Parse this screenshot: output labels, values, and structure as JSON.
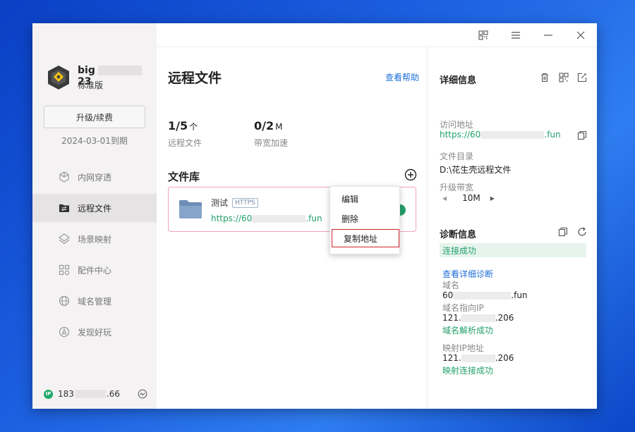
{
  "sidebar": {
    "user": {
      "name_prefix": "big",
      "name_suffix": "23",
      "edition": "标准版"
    },
    "upgrade_button": "升级/续费",
    "expire": "2024-03-01到期",
    "nav": [
      {
        "label": "内网穿透",
        "icon": "cube-icon"
      },
      {
        "label": "远程文件",
        "icon": "folder-transfer-icon",
        "active": true
      },
      {
        "label": "场景映射",
        "icon": "layers-icon"
      },
      {
        "label": "配件中心",
        "icon": "grid-icon"
      },
      {
        "label": "域名管理",
        "icon": "globe-icon"
      },
      {
        "label": "发现好玩",
        "icon": "compass-icon"
      }
    ],
    "ip": {
      "badge": "IP",
      "prefix": "183",
      "suffix": ".66"
    }
  },
  "main": {
    "title": "远程文件",
    "help_link": "查看帮助",
    "stats": [
      {
        "value": "1/5",
        "unit": "个",
        "label": "远程文件"
      },
      {
        "value": "0/2",
        "unit": "M",
        "label": "带宽加速"
      }
    ],
    "library_title": "文件库",
    "file": {
      "name": "测试",
      "badge": "HTTPS",
      "url_prefix": "https://60",
      "url_suffix": ".fun"
    }
  },
  "context_menu": {
    "items": [
      "编辑",
      "删除",
      "复制地址"
    ]
  },
  "details": {
    "title": "详细信息",
    "access_label": "访问地址",
    "access_prefix": "https://60",
    "access_suffix": ".fun",
    "dir_label": "文件目录",
    "dir_value": "D:\\花生壳远程文件",
    "bandwidth_label": "升级带宽",
    "bandwidth_value": "10M"
  },
  "diagnosis": {
    "title": "诊断信息",
    "status": "连接成功",
    "detail_link": "查看详细诊断",
    "domain_label": "域名",
    "domain_prefix": "60",
    "domain_suffix": ".fun",
    "domain_ip_label": "域名指向IP",
    "domain_ip_prefix": "121.",
    "domain_ip_suffix": ".206",
    "domain_ok": "域名解析成功",
    "map_ip_label": "映射IP地址",
    "map_ip_prefix": "121.",
    "map_ip_suffix": ".206",
    "map_ok": "映射连接成功"
  },
  "colors": {
    "accent_green": "#22a06b",
    "link_blue": "#1e6fd9",
    "highlight_red": "#d2232a"
  }
}
